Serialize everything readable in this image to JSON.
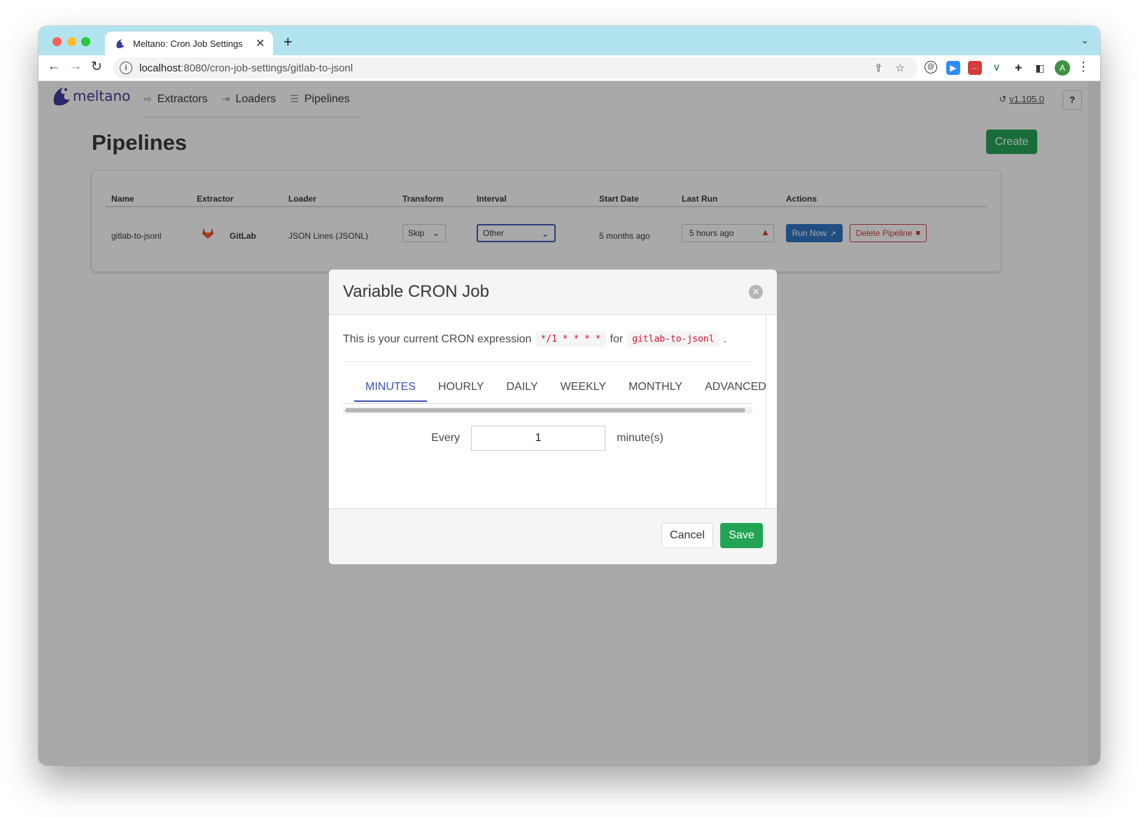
{
  "browser": {
    "tab_title": "Meltano: Cron Job Settings",
    "tab_close": "✕",
    "new_tab": "+",
    "tabs_menu": "⌄",
    "url_host": "localhost",
    "url_rest": ":8080/cron-job-settings/gitlab-to-jsonl",
    "avatar_letter": "A"
  },
  "app": {
    "brand": "meltano",
    "nav": [
      {
        "label": "Extractors",
        "icon": "extractor-icon"
      },
      {
        "label": "Loaders",
        "icon": "loader-icon"
      },
      {
        "label": "Pipelines",
        "icon": "pipelines-icon"
      }
    ],
    "version": "v1.105.0",
    "help": "?"
  },
  "page": {
    "title": "Pipelines",
    "create_label": "Create"
  },
  "table": {
    "headers": {
      "name": "Name",
      "extractor": "Extractor",
      "loader": "Loader",
      "transform": "Transform",
      "interval": "Interval",
      "start_date": "Start Date",
      "last_run": "Last Run",
      "actions": "Actions"
    },
    "row": {
      "name": "gitlab-to-jsonl",
      "extractor": "GitLab",
      "loader": "JSON Lines (JSONL)",
      "transform": "Skip",
      "interval": "Other",
      "start_date": "5 months ago",
      "last_run": "5 hours ago",
      "run_now": "Run Now",
      "delete": "Delete Pipeline"
    }
  },
  "modal": {
    "title": "Variable CRON Job",
    "close": "✕",
    "expr_prefix": "This is your current CRON expression",
    "expr": "*/1 * * * *",
    "expr_for": "for",
    "pipeline": "gitlab-to-jsonl",
    "expr_suffix": ".",
    "tabs": [
      "MINUTES",
      "HOURLY",
      "DAILY",
      "WEEKLY",
      "MONTHLY",
      "ADVANCED"
    ],
    "active_tab": "MINUTES",
    "every_label": "Every",
    "every_value": "1",
    "unit_label": "minute(s)",
    "cancel": "Cancel",
    "save": "Save"
  },
  "colors": {
    "tab_strip": "#b2e4ef",
    "primary_green": "#23a455",
    "run_blue": "#2f73c3",
    "danger_red": "#cc3b3b",
    "tab_active": "#3f51b5"
  }
}
